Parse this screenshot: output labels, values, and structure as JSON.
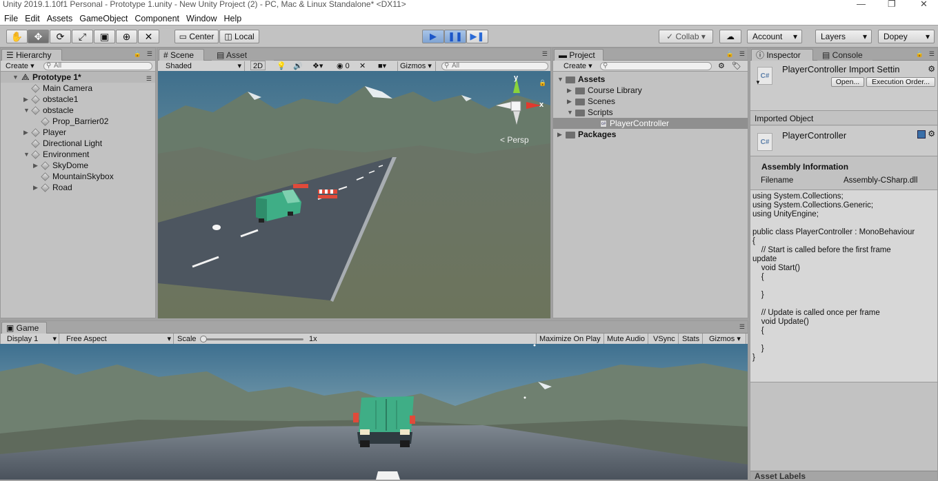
{
  "window": {
    "title": "Unity 2019.1.10f1 Personal - Prototype 1.unity - New Unity Project (2) - PC, Mac & Linux Standalone* <DX11>",
    "controls": [
      "—",
      "❐",
      "✕"
    ]
  },
  "menu": [
    "File",
    "Edit",
    "Assets",
    "GameObject",
    "Component",
    "Window",
    "Help"
  ],
  "toolbar": {
    "tools": [
      "hand-tool",
      "move-tool",
      "rotate-tool",
      "scale-tool",
      "rect-tool",
      "transform-tool",
      "custom-tool"
    ],
    "pivot_label": "Center",
    "space_label": "Local",
    "collab_label": "Collab",
    "account_label": "Account",
    "layers_label": "Layers",
    "layout_label": "Dopey"
  },
  "hierarchy": {
    "tab": "Hierarchy",
    "create": "Create",
    "search_placeholder": "All",
    "scene_name": "Prototype 1*",
    "items": [
      {
        "label": "Main Camera",
        "depth": 1,
        "arrow": ""
      },
      {
        "label": "obstacle1",
        "depth": 1,
        "arrow": "▶"
      },
      {
        "label": "obstacle",
        "depth": 1,
        "arrow": "▼"
      },
      {
        "label": "Prop_Barrier02",
        "depth": 2,
        "arrow": ""
      },
      {
        "label": "Player",
        "depth": 1,
        "arrow": "▶"
      },
      {
        "label": "Directional Light",
        "depth": 1,
        "arrow": ""
      },
      {
        "label": "Environment",
        "depth": 1,
        "arrow": "▼"
      },
      {
        "label": "SkyDome",
        "depth": 2,
        "arrow": "▶"
      },
      {
        "label": "MountainSkybox",
        "depth": 2,
        "arrow": ""
      },
      {
        "label": "Road",
        "depth": 2,
        "arrow": "▶"
      }
    ]
  },
  "scene": {
    "tab_scene": "Scene",
    "tab_store": "Asset Store",
    "shading": "Shaded",
    "mode_2d": "2D",
    "hidden_count": "0",
    "gizmos": "Gizmos",
    "search_placeholder": "All",
    "persp_label": "Persp",
    "axis_y": "y",
    "axis_x": "x"
  },
  "project": {
    "tab": "Project",
    "create": "Create",
    "items": [
      {
        "label": "Assets",
        "depth": 0,
        "arrow": "▼",
        "bold": true
      },
      {
        "label": "Course Library",
        "depth": 1,
        "arrow": "▶"
      },
      {
        "label": "Scenes",
        "depth": 1,
        "arrow": "▶"
      },
      {
        "label": "Scripts",
        "depth": 1,
        "arrow": "▼"
      },
      {
        "label": "PlayerController",
        "depth": 2,
        "arrow": "",
        "selected": true
      },
      {
        "label": "Packages",
        "depth": 0,
        "arrow": "▶",
        "bold": true
      }
    ]
  },
  "inspector": {
    "tab_inspector": "Inspector",
    "tab_console": "Console",
    "title": "PlayerController Import Settin",
    "open_btn": "Open...",
    "exec_btn": "Execution Order...",
    "imported_object": "Imported Object",
    "object_name": "PlayerController",
    "cs_label": "C#",
    "assembly_heading": "Assembly Information",
    "filename_label": "Filename",
    "filename_value": "Assembly-CSharp.dll",
    "code": "using System.Collections;\nusing System.Collections.Generic;\nusing UnityEngine;\n\npublic class PlayerController : MonoBehaviour\n{\n    // Start is called before the first frame\nupdate\n    void Start()\n    {\n\n    }\n\n    // Update is called once per frame\n    void Update()\n    {\n\n    }\n}",
    "asset_labels": "Asset Labels"
  },
  "game": {
    "tab": "Game",
    "display": "Display 1",
    "aspect": "Free Aspect",
    "scale_label": "Scale",
    "scale_value": "1x",
    "maximize": "Maximize On Play",
    "mute": "Mute Audio",
    "vsync": "VSync",
    "stats": "Stats",
    "gizmos": "Gizmos"
  },
  "colors": {
    "selected_row": "#8f8f8f",
    "play_blue": "#2a6ad6",
    "axis_red": "#e03a2e",
    "axis_green": "#8ad33a",
    "van": "#3fae86"
  }
}
